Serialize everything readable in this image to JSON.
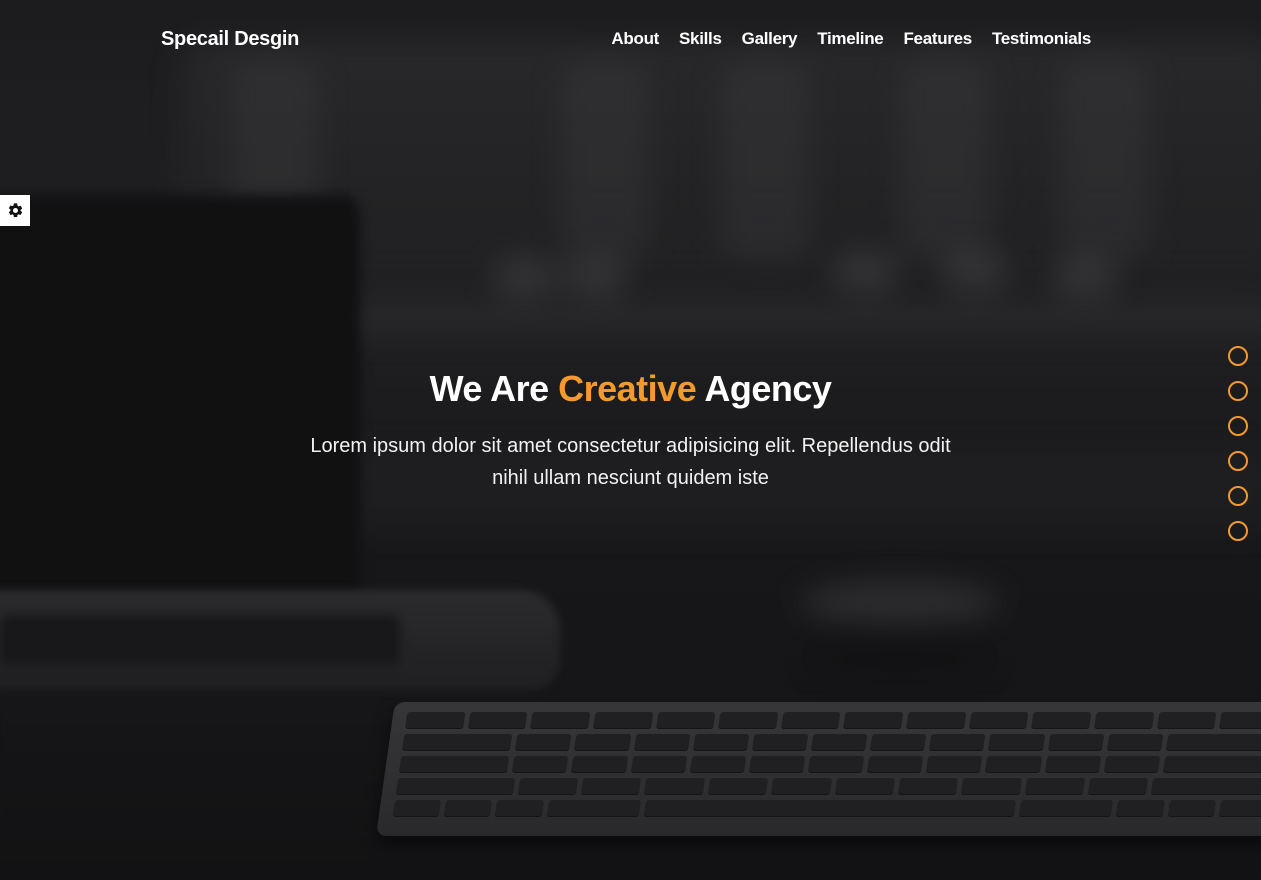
{
  "header": {
    "logo": "Specail Desgin",
    "nav": [
      "About",
      "Skills",
      "Gallery",
      "Timeline",
      "Features",
      "Testimonials"
    ]
  },
  "settings": {
    "icon": "gear-icon"
  },
  "hero": {
    "title_start": "We Are",
    "title_accent": "Creative",
    "title_end": "Agency",
    "description": "Lorem ipsum dolor sit amet consectetur adipisicing elit. Repellendus odit nihil ullam nesciunt quidem iste"
  },
  "bullets": {
    "count": 6
  },
  "colors": {
    "accent": "#f29a2e",
    "text": "#ffffff",
    "background": "#1c1c1e"
  }
}
